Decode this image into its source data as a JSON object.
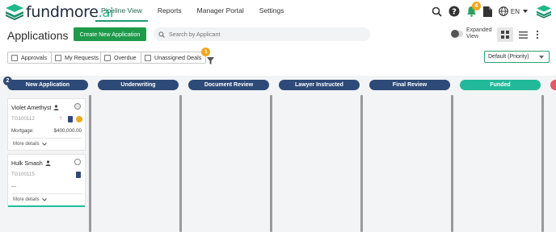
{
  "app": {
    "logo_text": "fundmore",
    "logo_suffix": ".ai",
    "nav": [
      {
        "label": "Pipeline View",
        "active": true
      },
      {
        "label": "Reports"
      },
      {
        "label": "Manager Portal"
      },
      {
        "label": "Settings"
      }
    ],
    "notification_count": "4",
    "language": "EN"
  },
  "header": {
    "title": "Applications",
    "create_button": "Create New Application",
    "search_placeholder": "Search by Applicant",
    "expanded_view_label": "Expanded View"
  },
  "filters": {
    "chips": [
      {
        "label": "Approvals"
      },
      {
        "label": "My Requests"
      },
      {
        "label": "Overdue"
      },
      {
        "label": "Unassigned Deals",
        "badge": "1"
      }
    ],
    "sort_selected": "Default (Priority)"
  },
  "columns": [
    {
      "label": "New Application",
      "color": "#2e4a78",
      "count": "2"
    },
    {
      "label": "Underwriting",
      "color": "#2e4a78"
    },
    {
      "label": "Document Review",
      "color": "#2e4a78"
    },
    {
      "label": "Lawyer Instructed",
      "color": "#2e4a78"
    },
    {
      "label": "Final Review",
      "color": "#2e4a78"
    },
    {
      "label": "Funded",
      "color": "#22b99a"
    }
  ],
  "cards": [
    {
      "name": "Violet Amethyst",
      "id": "TG100112",
      "line_label": "Mortgage:",
      "line_value": "$400,000.00",
      "more": "More details"
    },
    {
      "name": "Hulk Smash",
      "id": "TG100115",
      "line_label": "---",
      "more": "More details"
    }
  ],
  "colors": {
    "accent_green": "#1d9b4b",
    "column_navy": "#2e4a78",
    "funded_teal": "#22b99a",
    "badge_orange": "#f0a820"
  }
}
